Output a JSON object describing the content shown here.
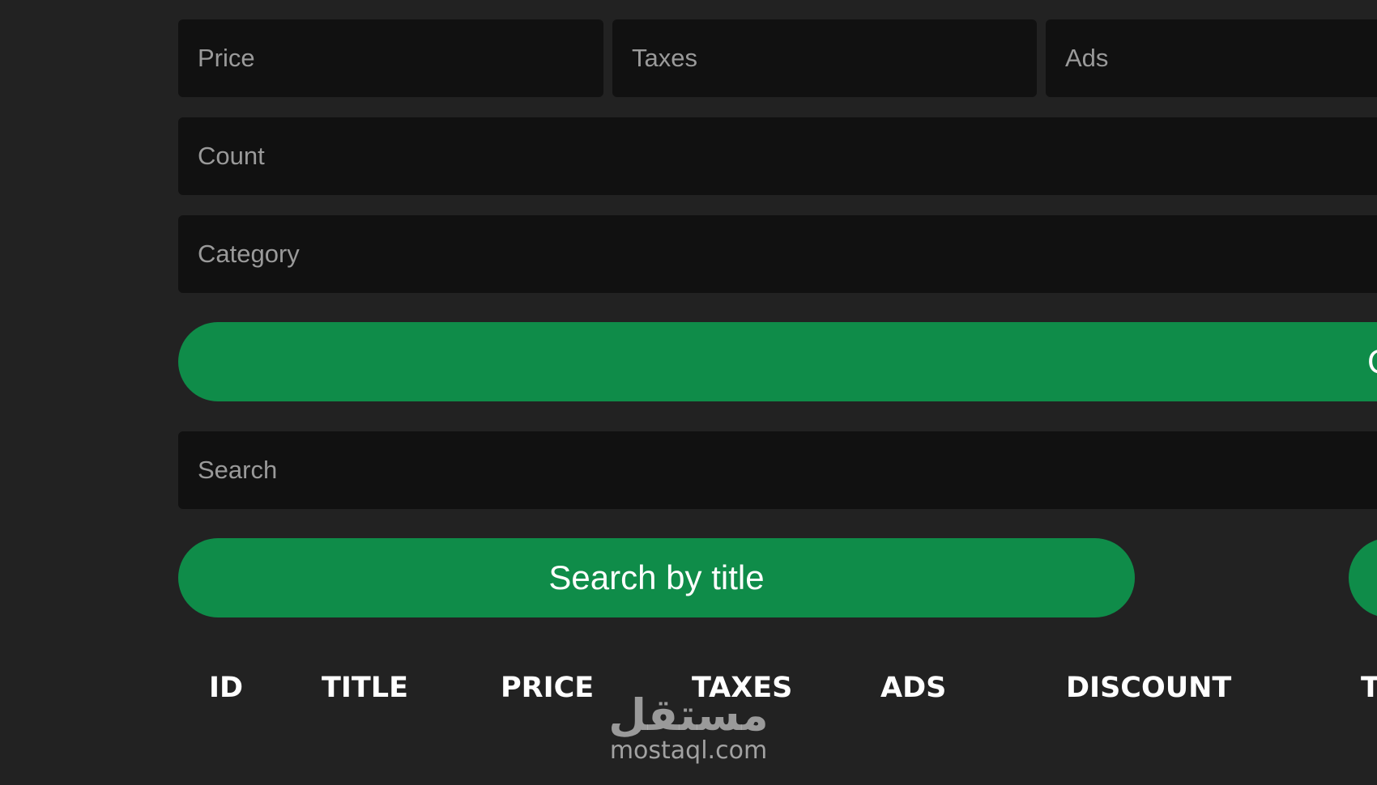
{
  "form": {
    "price_placeholder": "Price",
    "taxes_placeholder": "Taxes",
    "ads_placeholder": "Ads",
    "count_placeholder": "Count",
    "category_placeholder": "Category",
    "create_label": "Create",
    "search_placeholder": "Search",
    "search_by_title_label": "Search by title"
  },
  "table": {
    "headers": [
      "ID",
      "TITLE",
      "PRICE",
      "TAXES",
      "ADS",
      "DISCOUNT",
      "T"
    ]
  },
  "watermark": {
    "arabic": "مستقل",
    "latin": "mostaql.com"
  },
  "colors": {
    "background": "#222222",
    "input_background": "#111111",
    "accent_green": "#0f8c49",
    "text": "#ffffff"
  }
}
